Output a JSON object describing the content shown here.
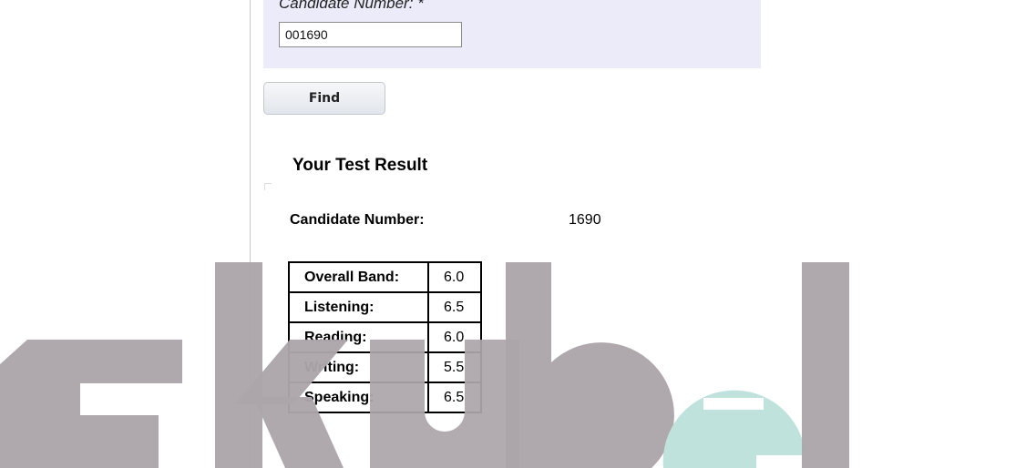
{
  "form": {
    "candidate_label": "Candidate Number: *",
    "candidate_value": "001690",
    "find_label": "Find"
  },
  "result": {
    "heading": "Your Test Result",
    "candidate_label": "Candidate Number:",
    "candidate_value": "1690",
    "scores": [
      {
        "label": "Overall Band:",
        "value": "6.0"
      },
      {
        "label": "Listening:",
        "value": "6.5"
      },
      {
        "label": "Reading:",
        "value": "6.0"
      },
      {
        "label": "Writing:",
        "value": "5.5"
      },
      {
        "label": "Speaking:",
        "value": "6.5"
      }
    ]
  },
  "watermark": {
    "text": "skubel",
    "colors": {
      "grey": "#aca6aa",
      "teal": "#bfe3dc"
    }
  }
}
